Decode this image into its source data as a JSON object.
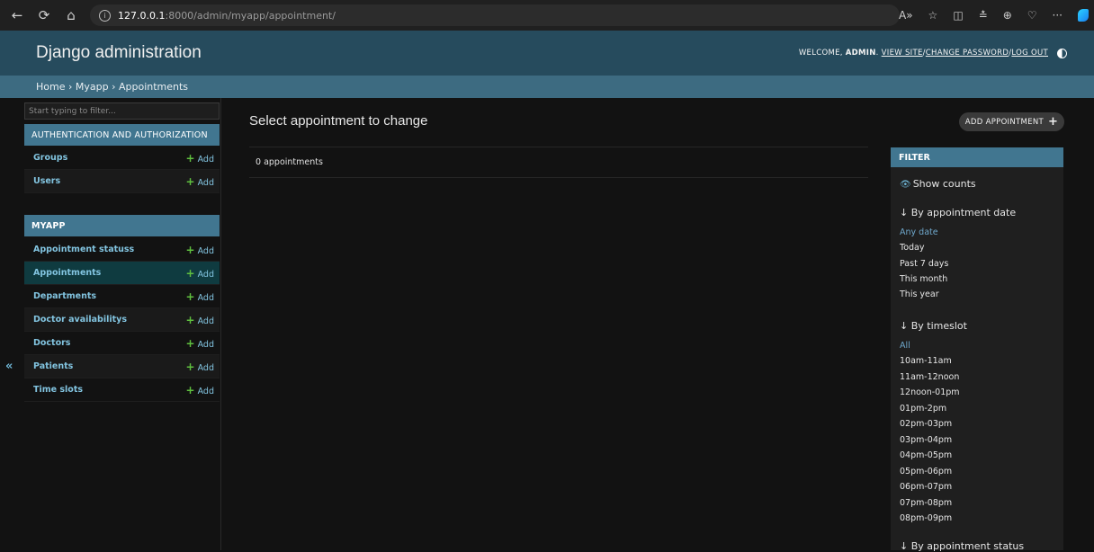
{
  "browser": {
    "url_host": "127.0.0.1",
    "url_rest": ":8000/admin/myapp/appointment/"
  },
  "header": {
    "branding": "Django administration",
    "welcome": "WELCOME,",
    "user": "ADMIN",
    "view_site": "VIEW SITE",
    "change_password": "CHANGE PASSWORD",
    "log_out": "LOG OUT",
    "sep": " / "
  },
  "breadcrumbs": "Home › Myapp › Appointments",
  "sidebar": {
    "filter_placeholder": "Start typing to filter...",
    "toggle": "«",
    "auth": {
      "caption": "AUTHENTICATION AND AUTHORIZATION",
      "models": [
        {
          "name": "Groups",
          "add": "Add"
        },
        {
          "name": "Users",
          "add": "Add"
        }
      ]
    },
    "myapp": {
      "caption": "MYAPP",
      "models": [
        {
          "name": "Appointment statuss",
          "add": "Add"
        },
        {
          "name": "Appointments",
          "add": "Add"
        },
        {
          "name": "Departments",
          "add": "Add"
        },
        {
          "name": "Doctor availabilitys",
          "add": "Add"
        },
        {
          "name": "Doctors",
          "add": "Add"
        },
        {
          "name": "Patients",
          "add": "Add"
        },
        {
          "name": "Time slots",
          "add": "Add"
        }
      ]
    }
  },
  "main": {
    "title": "Select appointment to change",
    "result_count": "0 appointments",
    "add_button": "ADD APPOINTMENT"
  },
  "filter": {
    "heading": "FILTER",
    "show_counts": "Show counts",
    "by_date": {
      "title": "↓ By appointment date",
      "options": [
        "Any date",
        "Today",
        "Past 7 days",
        "This month",
        "This year"
      ]
    },
    "by_timeslot": {
      "title": "↓ By timeslot",
      "options": [
        "All",
        "10am-11am",
        "11am-12noon",
        "12noon-01pm",
        "01pm-2pm",
        "02pm-03pm",
        "03pm-04pm",
        "04pm-05pm",
        "05pm-06pm",
        "06pm-07pm",
        "07pm-08pm",
        "08pm-09pm"
      ]
    },
    "by_status": {
      "title": "↓ By appointment status"
    }
  },
  "colors": {
    "header_bg": "#264b5d",
    "breadcrumb_bg": "#3d6b81",
    "caption_bg": "#417690",
    "link": "#82c4e0",
    "add_plus": "#5fbf3f"
  }
}
